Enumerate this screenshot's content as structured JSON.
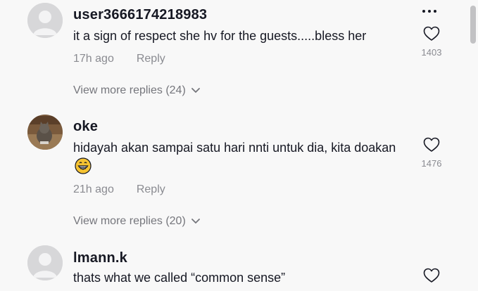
{
  "comments": [
    {
      "username": "user3666174218983",
      "text": "it a sign of respect she hv for the guests.....bless her",
      "time": "17h ago",
      "reply_label": "Reply",
      "like_count": "1403",
      "view_more": "View more replies (24)",
      "avatar": "default-avatar"
    },
    {
      "username": "oke",
      "text": "hidayah akan sampai satu hari nnti untuk dia, kita doakan",
      "emoji": "😁",
      "time": "21h ago",
      "reply_label": "Reply",
      "like_count": "1476",
      "view_more": "View more replies (20)",
      "avatar": "cat-photo-avatar"
    },
    {
      "username": "lmann.k",
      "text": "thats what we called “common sense”",
      "avatar": "default-avatar"
    }
  ],
  "colors": {
    "background": "#f8f8f8",
    "text_primary": "#161823",
    "text_secondary": "#8a8b91"
  }
}
